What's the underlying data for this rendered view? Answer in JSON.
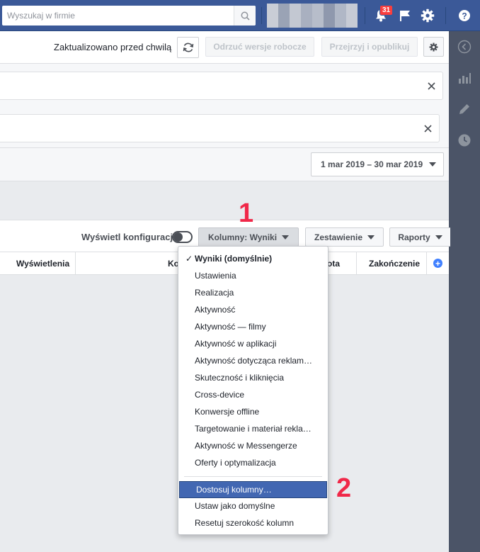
{
  "topbar": {
    "search_placeholder": "Wyszukaj w firmie",
    "notifications_count": "31",
    "icons": [
      "search-icon",
      "bell-icon",
      "flag-icon",
      "gear-icon",
      "help-icon"
    ]
  },
  "header": {
    "updated_text": "Zaktualizowano przed chwilą",
    "discard_label": "Odrzuć wersje robocze",
    "review_label": "Przejrzyj i opublikuj"
  },
  "date_range": {
    "label": "1 mar 2019 – 30 mar 2019"
  },
  "toolbar": {
    "toggle_label": "Wyświetl konfigurację",
    "columns_label": "Kolumny: Wyniki",
    "breakdown_label": "Zestawienie",
    "reports_label": "Raporty"
  },
  "table": {
    "columns": {
      "impressions": "Wyświetlenia",
      "cost_partial": "Ko",
      "amount_partial": "ota",
      "end": "Zakończenie"
    }
  },
  "dropdown": {
    "items": [
      {
        "label": "Wyniki (domyślnie)",
        "checked": true
      },
      {
        "label": "Ustawienia"
      },
      {
        "label": "Realizacja"
      },
      {
        "label": "Aktywność"
      },
      {
        "label": "Aktywność — filmy"
      },
      {
        "label": "Aktywność w aplikacji"
      },
      {
        "label": "Aktywność dotycząca reklam…"
      },
      {
        "label": "Skuteczność i kliknięcia"
      },
      {
        "label": "Cross-device"
      },
      {
        "label": "Konwersje offline"
      },
      {
        "label": "Targetowanie i materiał rekla…"
      },
      {
        "label": "Aktywność w Messengerze"
      },
      {
        "label": "Oferty i optymalizacja"
      }
    ],
    "actions": [
      {
        "label": "Dostosuj kolumny…",
        "highlighted": true
      },
      {
        "label": "Ustaw jako domyślne"
      },
      {
        "label": "Resetuj szerokość kolumn"
      }
    ],
    "check_glyph": "✓"
  },
  "annotations": {
    "step1": "1",
    "step2": "2"
  },
  "colors": {
    "topbar": "#3b5998",
    "sidebar": "#4b5467",
    "highlight": "#4267b2",
    "annotation": "#f02849"
  }
}
